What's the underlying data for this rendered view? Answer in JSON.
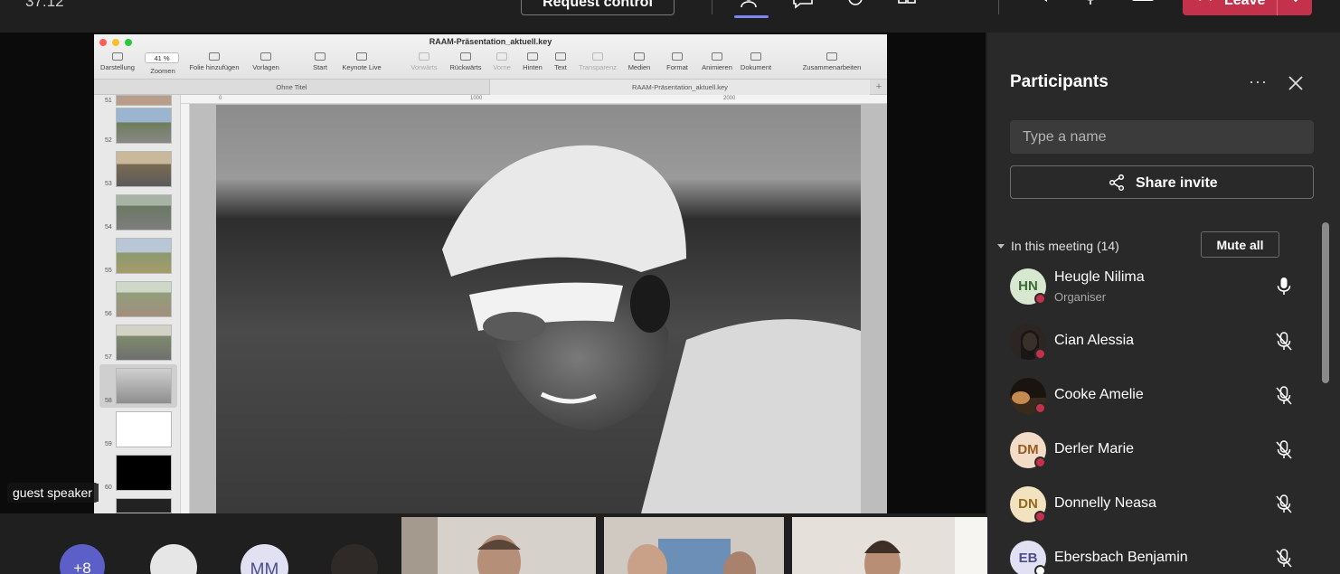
{
  "topbar": {
    "timer": "37:12",
    "request_control_label": "Request control",
    "leave_label": "Leave",
    "icons": [
      "people-icon",
      "chat-icon",
      "reactions-icon",
      "rooms-icon",
      "more-icon",
      "camera-icon",
      "mic-icon",
      "share-tray-icon",
      "phone-icon",
      "chevron-down-icon"
    ],
    "accent": "#7f85f5",
    "leave_color": "#c4314b"
  },
  "shared_screen": {
    "app_title": "RAAM-Präsentation_aktuell.key",
    "zoom": "41 %",
    "toolbar": [
      {
        "label": "Darstellung",
        "enabled": true
      },
      {
        "label": "Zoomen",
        "enabled": true
      },
      {
        "label": "Folie hinzufügen",
        "enabled": true
      },
      {
        "label": "Vorlagen",
        "enabled": true
      },
      {
        "label": "Start",
        "enabled": true
      },
      {
        "label": "Keynote Live",
        "enabled": true
      },
      {
        "label": "Vorwärts",
        "enabled": false
      },
      {
        "label": "Rückwärts",
        "enabled": true
      },
      {
        "label": "Vorne",
        "enabled": false
      },
      {
        "label": "Hinten",
        "enabled": true
      },
      {
        "label": "Text",
        "enabled": true
      },
      {
        "label": "Transparenz",
        "enabled": false
      },
      {
        "label": "Medien",
        "enabled": true
      },
      {
        "label": "Format",
        "enabled": true
      },
      {
        "label": "Animieren",
        "enabled": true
      },
      {
        "label": "Dokument",
        "enabled": true
      },
      {
        "label": "Zusammenarbeiten",
        "enabled": true
      }
    ],
    "tabs": [
      "Ohne Titel",
      "RAAM-Präsentation_aktuell.key"
    ],
    "tab_plus": "+",
    "ruler_marks": [
      "0",
      "1000",
      "2000"
    ],
    "slide_numbers": [
      "51",
      "52",
      "53",
      "54",
      "55",
      "56",
      "57",
      "58",
      "59",
      "60"
    ],
    "selected_slide": "58",
    "speaker_label": "guest speaker"
  },
  "strip": {
    "overflow_count": "+8",
    "initials": "MM"
  },
  "panel": {
    "title": "Participants",
    "more_label": "···",
    "search_placeholder": "Type a name",
    "share_invite_label": "Share invite",
    "in_meeting_label": "In this meeting (14)",
    "mute_all_label": "Mute all",
    "participants": [
      {
        "initials": "HN",
        "name": "Heugle Nilima",
        "role": "Organiser",
        "mic": "on",
        "avatar_bg": "#d8e8d0",
        "avatar_fg": "#3b6b35"
      },
      {
        "initials": "",
        "name": "Cian Alessia",
        "role": "",
        "mic": "off",
        "avatar_bg": "#2c2523",
        "avatar_fg": "#ffffff"
      },
      {
        "initials": "",
        "name": "Cooke Amelie",
        "role": "",
        "mic": "off",
        "avatar_bg": "#3a2a1c",
        "avatar_fg": "#ffffff"
      },
      {
        "initials": "DM",
        "name": "Derler Marie",
        "role": "",
        "mic": "off",
        "avatar_bg": "#f3dcc7",
        "avatar_fg": "#9a5a22"
      },
      {
        "initials": "DN",
        "name": "Donnelly Neasa",
        "role": "",
        "mic": "off",
        "avatar_bg": "#f3e2c0",
        "avatar_fg": "#8e6a1c"
      },
      {
        "initials": "EB",
        "name": "Ebersbach Benjamin",
        "role": "",
        "mic": "off",
        "avatar_bg": "#e1e1f3",
        "avatar_fg": "#4d4d8a"
      }
    ]
  }
}
